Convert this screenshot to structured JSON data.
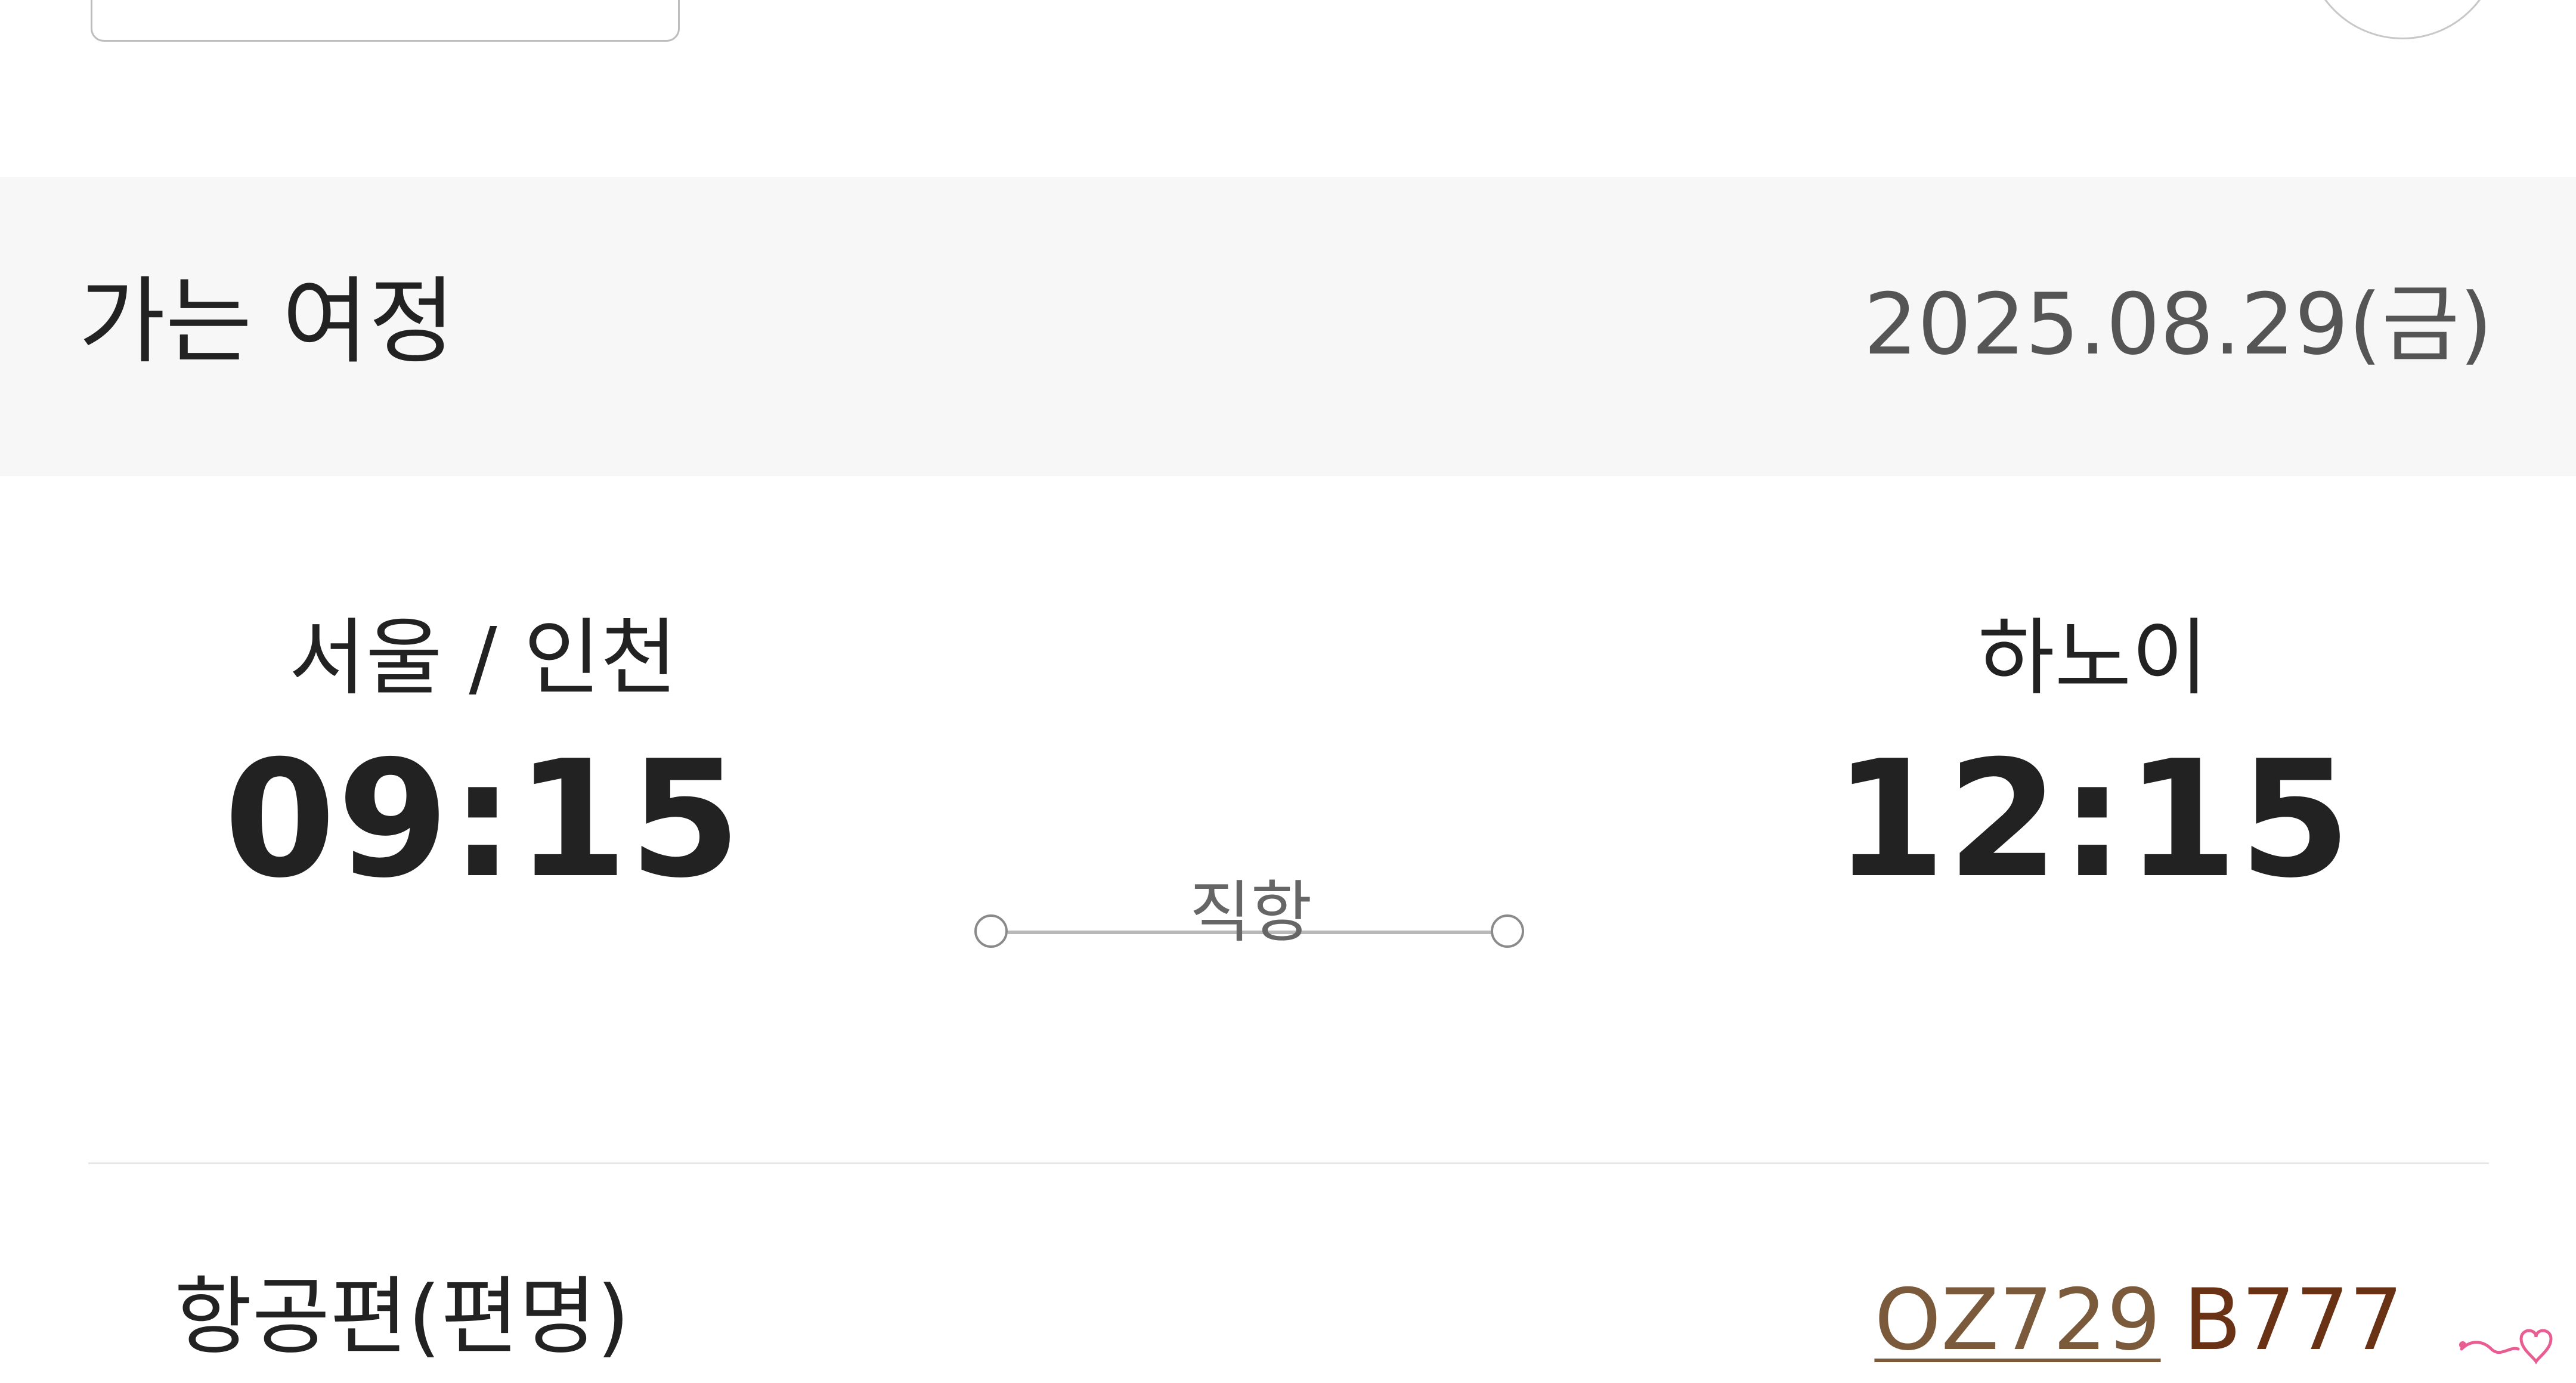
{
  "itinerary": {
    "title": "가는 여정",
    "date": "2025.08.29(금)"
  },
  "segment": {
    "departure": {
      "city": "서울 / 인천",
      "time": "09:15"
    },
    "arrival": {
      "city": "하노이",
      "time": "12:15"
    },
    "route_label": "직항"
  },
  "flight": {
    "label": "항공편(편명)",
    "number": "OZ729",
    "aircraft": "B777"
  },
  "colors": {
    "header_bg": "#f7f7f7",
    "flight_number": "#7a5a3a",
    "aircraft": "#6a3215",
    "watermark": "#e85d92"
  },
  "icons": {
    "route_start": "circle-icon",
    "route_end": "circle-icon",
    "watermark": "heart-logo"
  }
}
